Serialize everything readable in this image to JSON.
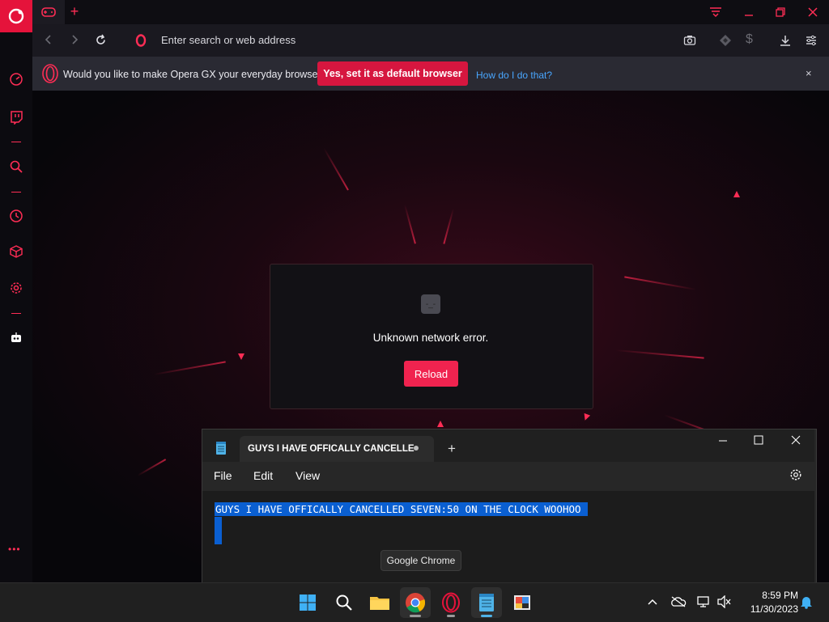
{
  "browser": {
    "address_placeholder": "Enter search or web address",
    "infobar": {
      "message": "Would you like to make Opera GX your everyday browser?",
      "default_button": "Yes, set it as default browser",
      "how_link": "How do I do that?",
      "close": "×"
    },
    "error": {
      "message": "Unknown network error.",
      "reload_label": "Reload"
    },
    "sidebar_more": "•••",
    "new_tab": "+"
  },
  "notepad": {
    "tab_title": "GUYS I HAVE OFFICALLY CANCELLE",
    "new_tab": "+",
    "menus": [
      "File",
      "Edit",
      "View"
    ],
    "content": "GUYS I HAVE OFFICALLY CANCELLED SEVEN:50 ON THE CLOCK WOOHOO"
  },
  "tooltip": "Google Chrome",
  "taskbar": {
    "time": "8:59 PM",
    "date": "11/30/2023"
  },
  "colors": {
    "accent": "#ff2d55",
    "selection": "#0a5fd1"
  }
}
